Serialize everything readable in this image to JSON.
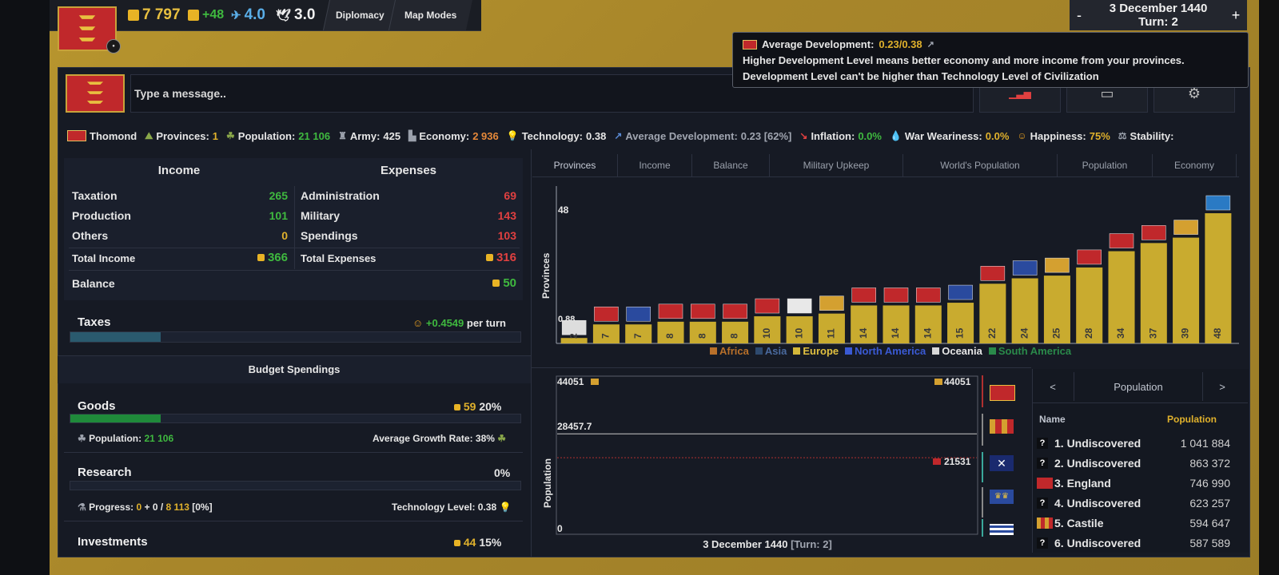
{
  "top": {
    "gold": "7 797",
    "gold_delta": "+48",
    "manpower": "4.0",
    "stability_val": "3.0",
    "tabs": [
      "Diplomacy",
      "Map Modes"
    ],
    "date": "3 December 1440",
    "turn": "Turn: 2",
    "minus": "-",
    "plus": "+"
  },
  "tooltip": {
    "title": "Average Development:",
    "title_value": "0.23/0.38",
    "line1": "Higher Development Level means better economy and more income from your provinces.",
    "line2": "Development Level can't be higher than Technology Level of Civilization"
  },
  "chat": {
    "placeholder": "Type a message.."
  },
  "stats": {
    "country": "Thomond",
    "provinces_label": "Provinces:",
    "provinces": "1",
    "population_label": "Population:",
    "population": "21 106",
    "army_label": "Army:",
    "army": "425",
    "economy_label": "Economy:",
    "economy": "2 936",
    "technology_label": "Technology:",
    "technology": "0.38",
    "avgdev_label": "Average Development:",
    "avgdev": "0.23 [62%]",
    "inflation_label": "Inflation:",
    "inflation": "0.0%",
    "war_label": "War Weariness:",
    "war": "0.0%",
    "happiness_label": "Happiness:",
    "happiness": "75%",
    "stability_label": "Stability:"
  },
  "income": {
    "title": "Income",
    "rows": [
      {
        "label": "Taxation",
        "value": "265"
      },
      {
        "label": "Production",
        "value": "101"
      },
      {
        "label": "Others",
        "value": "0"
      }
    ],
    "total_label": "Total Income",
    "total": "366"
  },
  "expenses": {
    "title": "Expenses",
    "rows": [
      {
        "label": "Administration",
        "value": "69"
      },
      {
        "label": "Military",
        "value": "143"
      },
      {
        "label": "Spendings",
        "value": "103"
      }
    ],
    "total_label": "Total Expenses",
    "total": "316"
  },
  "balance": {
    "label": "Balance",
    "value": "50"
  },
  "taxes": {
    "label": "Taxes",
    "value": "+0.4549",
    "suffix": "per turn",
    "level": 0.2
  },
  "budget": {
    "title": "Budget Spendings",
    "goods": {
      "label": "Goods",
      "value": "59",
      "pct": "20%",
      "level": 0.2
    },
    "population_label": "Population:",
    "population": "21 106",
    "growth_label": "Average Growth Rate: 38%",
    "research": {
      "label": "Research",
      "pct": "0%"
    },
    "progress_label": "Progress:",
    "progress_a": "0",
    "progress_plus": "+ 0 /",
    "progress_b": "8 113",
    "progress_pct": "[0%]",
    "tech_level": "Technology Level: 0.38",
    "investments": {
      "label": "Investments",
      "value": "44",
      "pct": "15%"
    }
  },
  "chart_tabs": [
    "Provinces",
    "Income",
    "Balance",
    "Military Upkeep",
    "World's Population",
    "Population",
    "Economy"
  ],
  "legend": [
    {
      "name": "Africa",
      "color": "#b8702a"
    },
    {
      "name": "Asia",
      "color": "#2e4a6e"
    },
    {
      "name": "Europe",
      "color": "#d4b83a"
    },
    {
      "name": "North America",
      "color": "#3a5ad4"
    },
    {
      "name": "Oceania",
      "color": "#d8d8d8"
    },
    {
      "name": "South America",
      "color": "#2a8a4a"
    }
  ],
  "chart_data": [
    {
      "type": "bar",
      "ylabel": "Provinces",
      "ytick_top": "48",
      "ytick_bottom": "0.88",
      "ylim": [
        0,
        48
      ],
      "values": [
        2,
        7,
        7,
        8,
        8,
        8,
        10,
        10,
        11,
        14,
        14,
        14,
        15,
        22,
        24,
        25,
        28,
        34,
        37,
        39,
        48
      ],
      "bar_color": "#c9ab2f"
    },
    {
      "type": "line",
      "ylabel": "Population",
      "ylim": [
        0,
        44051
      ],
      "label_top": "44051",
      "label_mid": "28457.7",
      "label_low": "21531",
      "label_zero": "0",
      "series": [
        {
          "values": [
            28457.7,
            28457.7
          ],
          "color": "#c8c8c8"
        },
        {
          "values": [
            21531,
            21531
          ],
          "color": "#b03030"
        }
      ],
      "xlabel": "3 December 1440",
      "xlabel_turn": "[Turn: 2]"
    }
  ],
  "pop_table": {
    "title": "Population",
    "prev": "<",
    "next": ">",
    "col_name": "Name",
    "col_value": "Population",
    "rows": [
      {
        "name": "1. Undiscovered",
        "value": "1 041 884"
      },
      {
        "name": "2. Undiscovered",
        "value": "863 372"
      },
      {
        "name": "3. England",
        "value": "746 990"
      },
      {
        "name": "4. Undiscovered",
        "value": "623 257"
      },
      {
        "name": "5. Castile",
        "value": "594 647"
      },
      {
        "name": "6. Undiscovered",
        "value": "587 589"
      }
    ]
  }
}
